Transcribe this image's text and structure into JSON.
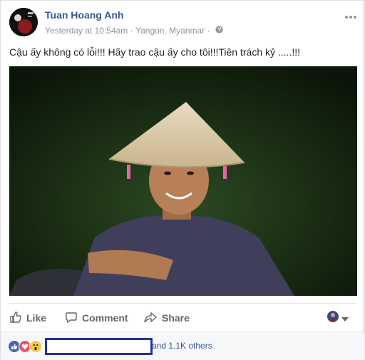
{
  "post": {
    "author": "Tuan Hoang Anh",
    "timestamp": "Yesterday at 10:54am",
    "separator": "·",
    "location": "Yangon, Myanmar",
    "text": "Cậu ấy không có lỗi!!! Hãy trao cậu ấy cho tôi!!!Tiên trách kỷ .....!!!",
    "more_icon": "ellipsis-icon",
    "privacy_icon": "globe-icon"
  },
  "actions": {
    "like_label": "Like",
    "comment_label": "Comment",
    "share_label": "Share"
  },
  "reactions": {
    "icons": [
      "like-reaction-icon",
      "love-reaction-icon",
      "wow-reaction-icon"
    ],
    "others_text": "and 1.1K others"
  },
  "colors": {
    "link": "#365899",
    "like": "#4267b2",
    "love": "#f25268",
    "wow": "#f7c94b",
    "redaction_border": "#2b3096"
  }
}
